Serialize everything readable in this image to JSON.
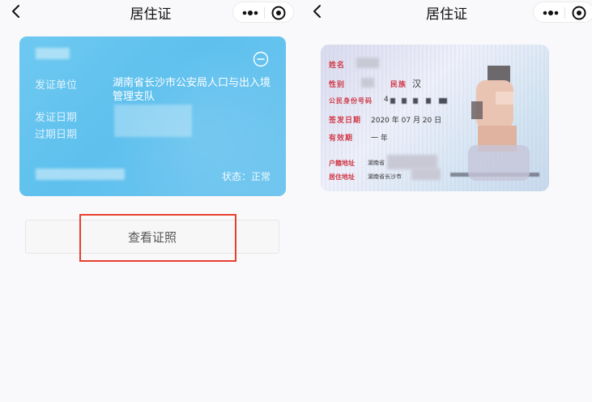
{
  "left": {
    "nav": {
      "title": "居住证"
    },
    "card": {
      "issuer_label": "发证单位",
      "issuer_value": "湖南省长沙市公安局人口与出入境管理支队",
      "issue_date_label": "发证日期",
      "expiry_date_label": "过期日期",
      "status": "状态：正常"
    },
    "view_button": "查看证照"
  },
  "right": {
    "nav": {
      "title": "居住证"
    },
    "id_card": {
      "name_label": "姓名",
      "gender_label": "性别",
      "ethnicity_label": "民族",
      "ethnicity_value": "汉",
      "id_number_label": "公民身份号码",
      "issue_date_label": "签发日期",
      "issue_date_value": "2020 年 07 月 20 日",
      "validity_label": "有效期",
      "validity_value": "一 年",
      "hukou_label": "户籍地址",
      "hukou_value": "湖南省",
      "residence_label": "居住地址",
      "residence_value": "湖南省长沙市"
    }
  },
  "colors": {
    "card_blue": "#5ec0ee",
    "highlight_red": "#e8402f",
    "id_label_red": "#d13a47"
  },
  "icons": [
    "back-icon",
    "more-dots-icon",
    "target-icon",
    "minus-circle-icon"
  ]
}
